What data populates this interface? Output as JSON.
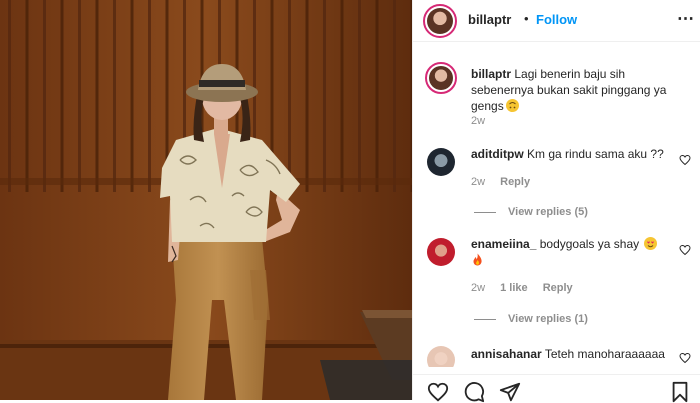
{
  "post": {
    "author": {
      "username": "billaptr",
      "follow_label": "Follow"
    },
    "caption": {
      "username": "billaptr",
      "text": "Lagi benerin baju sih sebenernya bukan sakit pinggang ya gengs",
      "emoji": "upside-down-face-emoji",
      "time": "2w"
    },
    "comments": [
      {
        "username": "aditditpw",
        "text": "Km ga rindu sama aku ??",
        "time": "2w",
        "reply_label": "Reply",
        "view_replies": "View replies (5)"
      },
      {
        "username": "enameiina_",
        "text": "bodygoals ya shay",
        "emojis": [
          "heart-eyes-emoji",
          "fire-emoji"
        ],
        "time": "2w",
        "likes": "1 like",
        "reply_label": "Reply",
        "view_replies": "View replies (1)"
      },
      {
        "username": "annisahanar",
        "text": "Teteh manoharaaaaaa"
      }
    ],
    "actions": [
      "heart-icon",
      "comment-icon",
      "share-icon",
      "bookmark-icon"
    ],
    "colors": {
      "follow": "#0095f6",
      "muted": "#8e8e8e",
      "wall": "#7a3e15",
      "avatar_ring": "#d62976"
    }
  }
}
